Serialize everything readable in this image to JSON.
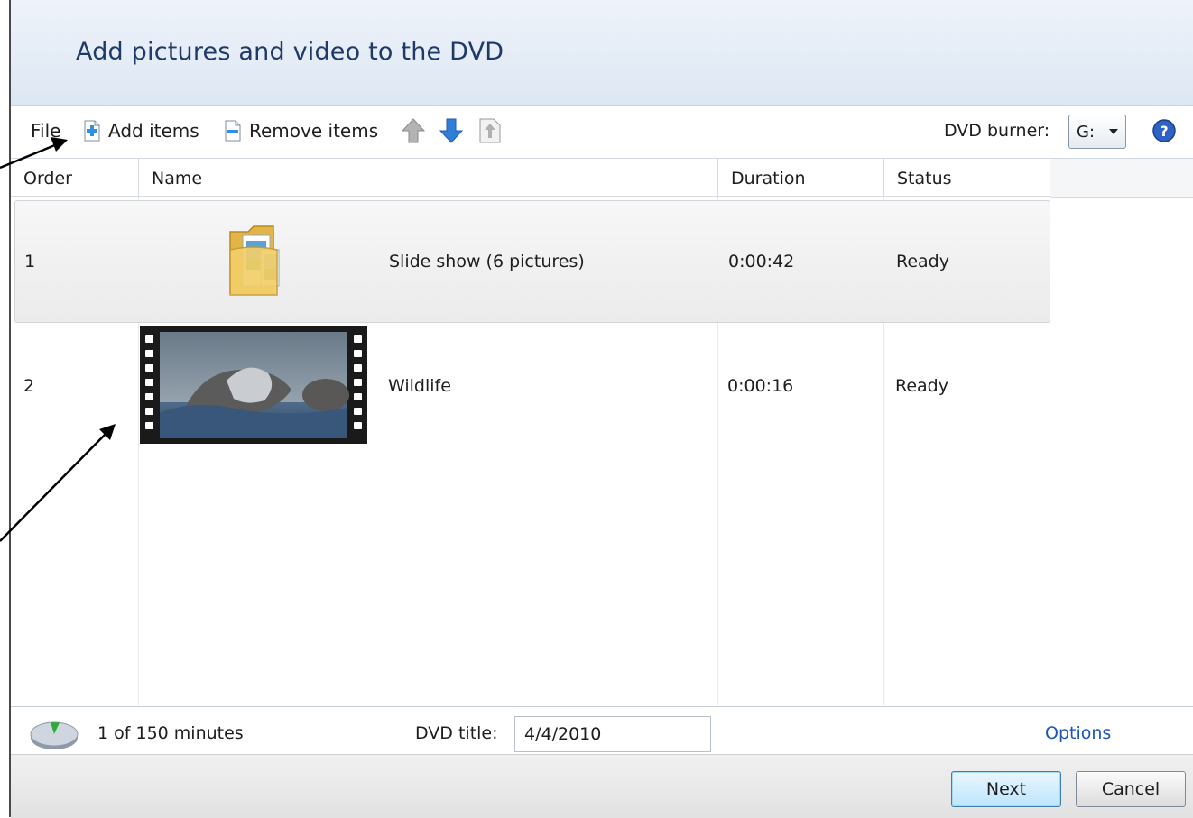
{
  "header": {
    "title": "Add pictures and video to the DVD"
  },
  "toolbar": {
    "file_label": "File",
    "add_label": "Add items",
    "remove_label": "Remove items",
    "move_up_icon": "arrow-up-icon",
    "move_down_icon": "arrow-down-icon",
    "move_top_icon": "move-to-top-icon",
    "burner_label": "DVD burner:",
    "burner_value": "G:",
    "help_icon": "help-icon"
  },
  "table": {
    "columns": [
      "Order",
      "Name",
      "Duration",
      "Status"
    ],
    "rows": [
      {
        "order": "1",
        "name": "Slide show (6 pictures)",
        "duration": "0:00:42",
        "status": "Ready",
        "thumbnail": "folder-icon",
        "selected": true
      },
      {
        "order": "2",
        "name": "Wildlife",
        "duration": "0:00:16",
        "status": "Ready",
        "thumbnail": "video-thumbnail",
        "selected": false
      }
    ]
  },
  "bottom": {
    "minutes": "1 of 150 minutes",
    "title_label": "DVD title:",
    "title_value": "4/4/2010",
    "options_label": "Options"
  },
  "footer": {
    "next_label": "Next",
    "cancel_label": "Cancel"
  },
  "colors": {
    "title": "#1f3a68",
    "link": "#1a56b8",
    "accent_blue": "#2f7fd8"
  }
}
